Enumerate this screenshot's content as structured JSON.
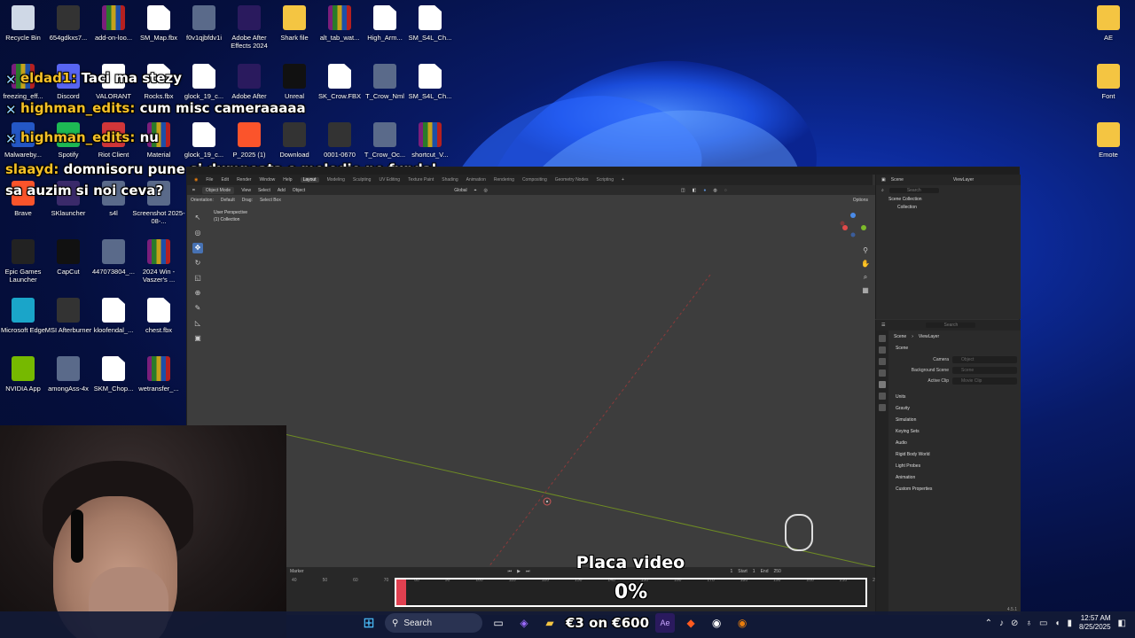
{
  "desktop_icons": [
    {
      "label": "Recycle Bin",
      "icon": "recycle-bin-icon"
    },
    {
      "label": "654gdkxs7...",
      "icon": "video-icon"
    },
    {
      "label": "add-on-loo...",
      "icon": "winrar-icon"
    },
    {
      "label": "SM_Map.fbx",
      "icon": "file-icon"
    },
    {
      "label": "f0v1qjbfdv1i",
      "icon": "image-icon"
    },
    {
      "label": "Adobe After Effects 2024",
      "icon": "after-effects-icon"
    },
    {
      "label": "Shark file",
      "icon": "folder-icon"
    },
    {
      "label": "alt_tab_wat...",
      "icon": "winrar-icon"
    },
    {
      "label": "High_Arm...",
      "icon": "file-icon"
    },
    {
      "label": "SM_S4L_Ch...",
      "icon": "file-icon"
    },
    {
      "label": "freezing_eff...",
      "icon": "winrar-icon"
    },
    {
      "label": "Discord",
      "icon": "discord-icon"
    },
    {
      "label": "VALORANT",
      "icon": "valorant-icon"
    },
    {
      "label": "Rocks.fbx",
      "icon": "file-icon"
    },
    {
      "label": "glock_19_c...",
      "icon": "file-icon"
    },
    {
      "label": "Adobe After",
      "icon": "after-effects-icon"
    },
    {
      "label": "Unreal",
      "icon": "unreal-icon"
    },
    {
      "label": "SK_Crow.FBX",
      "icon": "file-icon"
    },
    {
      "label": "T_Crow_Nml",
      "icon": "image-icon"
    },
    {
      "label": "SM_S4L_Ch...",
      "icon": "file-icon"
    },
    {
      "label": "Malwareby...",
      "icon": "malwarebytes-icon"
    },
    {
      "label": "Spotify",
      "icon": "spotify-icon"
    },
    {
      "label": "Riot Client",
      "icon": "riot-icon"
    },
    {
      "label": "Material",
      "icon": "winrar-icon"
    },
    {
      "label": "glock_19_c...",
      "icon": "file-icon"
    },
    {
      "label": "P_2025 (1)",
      "icon": "brave-icon"
    },
    {
      "label": "Download",
      "icon": "video-icon"
    },
    {
      "label": "0001-0670",
      "icon": "video-icon"
    },
    {
      "label": "T_Crow_Oc...",
      "icon": "image-icon"
    },
    {
      "label": "shortcut_V...",
      "icon": "winrar-icon"
    },
    {
      "label": "Brave",
      "icon": "brave-icon"
    },
    {
      "label": "SKlauncher",
      "icon": "sklauncher-icon"
    },
    {
      "label": "s4l",
      "icon": "image-icon"
    },
    {
      "label": "Screenshot 2025-08-...",
      "icon": "image-icon"
    },
    {
      "label": "Epic Games Launcher",
      "icon": "epic-games-icon"
    },
    {
      "label": "CapCut",
      "icon": "capcut-icon"
    },
    {
      "label": "447073804_...",
      "icon": "image-icon"
    },
    {
      "label": "2024 Win - Vaszer's ...",
      "icon": "winrar-icon"
    },
    {
      "label": "Microsoft Edge",
      "icon": "edge-icon"
    },
    {
      "label": "MSI Afterburner",
      "icon": "msi-icon"
    },
    {
      "label": "kloofendal_...",
      "icon": "file-icon"
    },
    {
      "label": "chest.fbx",
      "icon": "file-icon"
    },
    {
      "label": "NVIDIA App",
      "icon": "nvidia-icon"
    },
    {
      "label": "amongAss-4x",
      "icon": "image-icon"
    },
    {
      "label": "SKM_Chop...",
      "icon": "file-icon"
    },
    {
      "label": "wetransfer_...",
      "icon": "winrar-icon"
    },
    {
      "label": "AE",
      "icon": "folder-icon"
    },
    {
      "label": "Font",
      "icon": "folder-icon"
    },
    {
      "label": "Emote",
      "icon": "folder-icon"
    }
  ],
  "chat": [
    {
      "user": "eldad1:",
      "message": "Taci ma stezy"
    },
    {
      "user": "highman_edits:",
      "message": "cum misc cameraaaaa"
    },
    {
      "user": "highman_edits:",
      "message": "nu"
    },
    {
      "user": "slaayd:",
      "message": "domnisoru pune si dumneata o melodie pe fundal sa auzim si noi ceva?"
    }
  ],
  "blender": {
    "menus": [
      "File",
      "Edit",
      "Render",
      "Window",
      "Help"
    ],
    "workspaces": [
      "Layout",
      "Modeling",
      "Sculpting",
      "UV Editing",
      "Texture Paint",
      "Shading",
      "Animation",
      "Rendering",
      "Compositing",
      "Geometry Nodes",
      "Scripting"
    ],
    "mode": "Object Mode",
    "header_menus": [
      "View",
      "Select",
      "Add",
      "Object"
    ],
    "orientation_label": "Orientation:",
    "orientation": "Default",
    "drag_label": "Drag:",
    "drag": "Select Box",
    "transform": "Global",
    "options": "Options",
    "viewport_title": "User Perspective",
    "viewport_collection": "(1) Collection",
    "outliner": {
      "scene": "Scene",
      "viewlayer": "ViewLayer",
      "search": "Search",
      "rows": [
        "Scene Collection",
        "Collection"
      ]
    },
    "props": {
      "search": "Search",
      "crumb": [
        "Scene",
        "ViewLayer"
      ],
      "section": "Scene",
      "fields": [
        {
          "label": "Camera",
          "value": "Object"
        },
        {
          "label": "Background Scene",
          "value": "Scene"
        },
        {
          "label": "Active Clip",
          "value": "Movie Clip"
        }
      ],
      "sections": [
        "Units",
        "Gravity",
        "Simulation",
        "Keying Sets",
        "Audio",
        "Rigid Body World",
        "Light Probes",
        "Animation",
        "Custom Properties"
      ]
    },
    "timeline": {
      "marker": "Marker",
      "frame": "1",
      "start_label": "Start",
      "start": "1",
      "end_label": "End",
      "end": "250",
      "ticks": [
        "40",
        "50",
        "60",
        "70",
        "80",
        "90",
        "100",
        "110",
        "120",
        "130",
        "140",
        "150",
        "160",
        "170",
        "180",
        "190",
        "200",
        "210",
        "220",
        "230",
        "240",
        "250"
      ]
    },
    "version": "4.5.1"
  },
  "gpu": {
    "title": "Placa video",
    "percent_text": "0%",
    "usage": 0,
    "fill_color": "#e04050"
  },
  "taskbar": {
    "search": "Search",
    "promo": "€3 on €600",
    "time": "12:57 AM",
    "date": "8/25/2025"
  }
}
